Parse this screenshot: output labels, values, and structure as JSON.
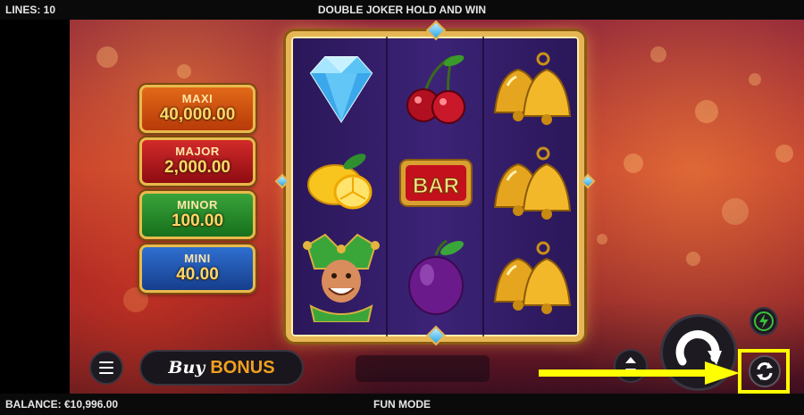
{
  "header": {
    "lines": "LINES: 10",
    "title": "DOUBLE JOKER HOLD AND WIN"
  },
  "footer": {
    "balance": "BALANCE: €10,996.00",
    "mode": "FUN MODE"
  },
  "jackpots": [
    {
      "name": "MAXI",
      "value": "40,000.00",
      "color": "#d2581a"
    },
    {
      "name": "MAJOR",
      "value": "2,000.00",
      "color": "#c0202a"
    },
    {
      "name": "MINOR",
      "value": "100.00",
      "color": "#2f9a32"
    },
    {
      "name": "MINI",
      "value": "40.00",
      "color": "#2a62c4"
    }
  ],
  "reels": [
    [
      "diamond",
      "lemon",
      "joker"
    ],
    [
      "cherries",
      "bar",
      "plum"
    ],
    [
      "bells",
      "bells",
      "bells"
    ]
  ],
  "symbols": {
    "bar_text": "BAR"
  },
  "buy_bonus": {
    "buy": "Buy",
    "bonus": "BONUS"
  },
  "highlight_color": "#ffff00",
  "icons": {
    "menu": "hamburger-menu-icon",
    "bet": "bet-up-down-icon",
    "spin": "spin-arrow-icon",
    "turbo": "lightning-icon",
    "autoplay": "autoplay-refresh-icon"
  }
}
